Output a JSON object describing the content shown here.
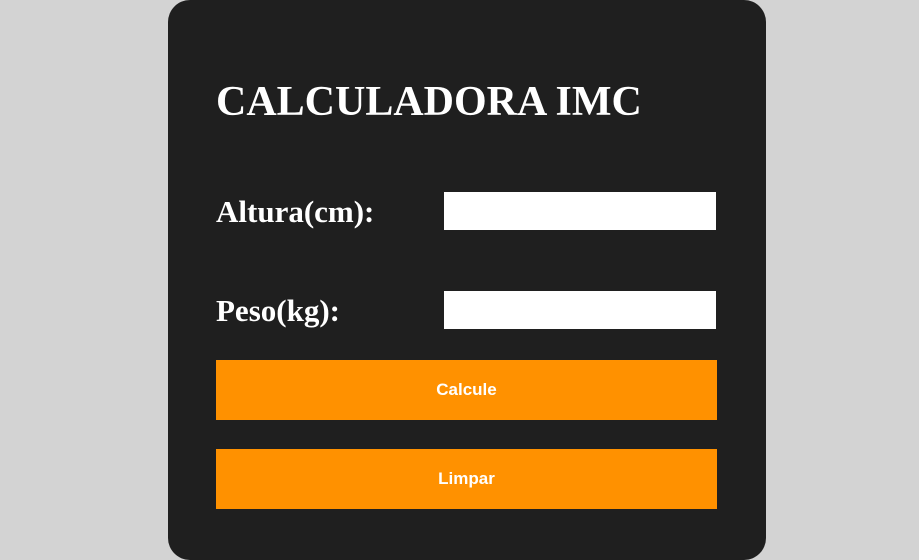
{
  "calculator": {
    "title": "CALCULADORA IMC",
    "height_label": "Altura(cm):",
    "height_value": "",
    "weight_label": "Peso(kg):",
    "weight_value": "",
    "calculate_button": "Calcule",
    "clear_button": "Limpar"
  },
  "colors": {
    "page_background": "#d3d3d3",
    "card_background": "#1f1f1f",
    "accent": "#ff9100",
    "text": "#ffffff",
    "input_background": "#ffffff"
  }
}
